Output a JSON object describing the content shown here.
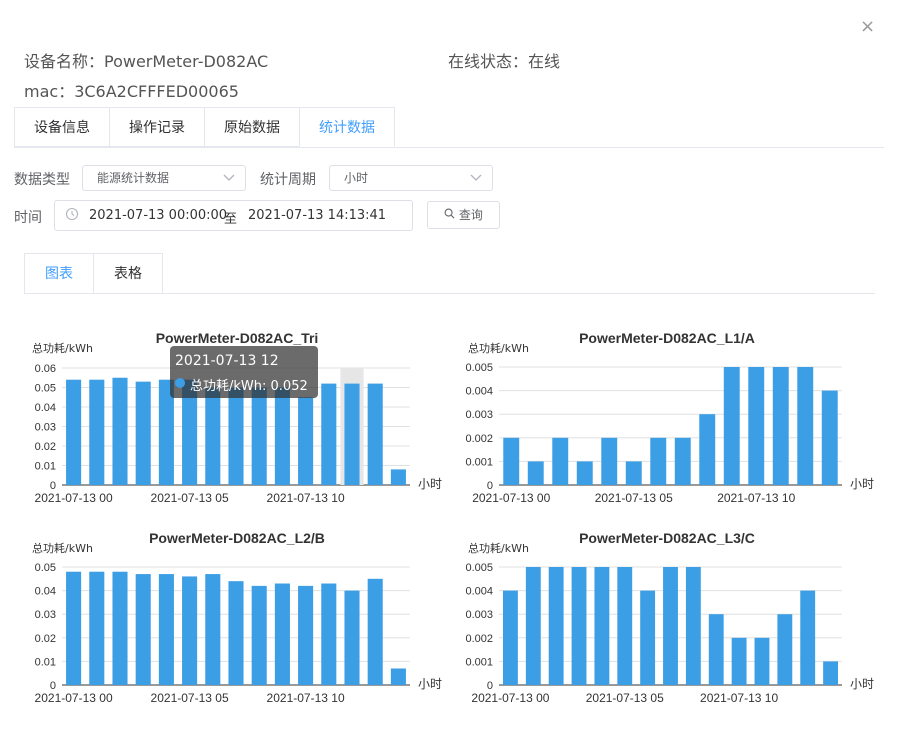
{
  "dialog": {
    "close_glyph": "×",
    "device_name": "设备名称：PowerMeter-D082AC",
    "online_status": "在线状态：在线",
    "mac": "mac：3C6A2CFFFED00065"
  },
  "tabs": [
    "设备信息",
    "操作记录",
    "原始数据",
    "统计数据"
  ],
  "filters": {
    "data_type_label": "数据类型",
    "data_type_value": "能源统计数据",
    "period_label": "统计周期",
    "period_value": "小时",
    "time_label": "时间",
    "start_time": "2021-07-13 00:00:00",
    "range_separator": "至",
    "end_time": "2021-07-13 14:13:41",
    "query_label": "查询",
    "icons": {
      "clock": "clock-icon",
      "search": "search-icon",
      "chevron": "chevron-down-icon"
    }
  },
  "view_tabs": [
    "图表",
    "表格"
  ],
  "tooltip": {
    "title": "2021-07-13 12",
    "value": "总功耗/kWh: 0.052"
  },
  "colors": {
    "bar": "#3c9ee5",
    "accent": "#409eff",
    "highlight": "#e6e6e6"
  },
  "chart_data": [
    {
      "type": "bar",
      "title": "PowerMeter-D082AC_Tri",
      "ylabel": "总功耗/kWh",
      "xlabel": "小时",
      "ylim": [
        0,
        0.06
      ],
      "yticks": [
        "0",
        "0.01",
        "0.02",
        "0.03",
        "0.04",
        "0.05",
        "0.06"
      ],
      "categories": [
        "2021-07-13 00",
        "2021-07-13 01",
        "2021-07-13 02",
        "2021-07-13 03",
        "2021-07-13 04",
        "2021-07-13 05",
        "2021-07-13 06",
        "2021-07-13 07",
        "2021-07-13 08",
        "2021-07-13 09",
        "2021-07-13 10",
        "2021-07-13 11",
        "2021-07-13 12",
        "2021-07-13 13",
        "2021-07-13 14"
      ],
      "xtick_labels": [
        "2021-07-13 00",
        "2021-07-13 05",
        "2021-07-13 10"
      ],
      "values": [
        0.054,
        0.054,
        0.055,
        0.053,
        0.054,
        0.054,
        0.05,
        0.05,
        0.05,
        0.05,
        0.045,
        0.052,
        0.052,
        0.052,
        0.008
      ],
      "highlight_index": 12,
      "grid": true
    },
    {
      "type": "bar",
      "title": "PowerMeter-D082AC_L1/A",
      "ylabel": "总功耗/kWh",
      "xlabel": "小时",
      "ylim": [
        0,
        0.005
      ],
      "yticks": [
        "0",
        "0.001",
        "0.002",
        "0.003",
        "0.004",
        "0.005"
      ],
      "categories": [
        "2021-07-13 00",
        "2021-07-13 01",
        "2021-07-13 02",
        "2021-07-13 03",
        "2021-07-13 04",
        "2021-07-13 05",
        "2021-07-13 06",
        "2021-07-13 07",
        "2021-07-13 08",
        "2021-07-13 09",
        "2021-07-13 10",
        "2021-07-13 11",
        "2021-07-13 12",
        "2021-07-13 13"
      ],
      "xtick_labels": [
        "2021-07-13 00",
        "2021-07-13 05",
        "2021-07-13 10"
      ],
      "values": [
        0.002,
        0.001,
        0.002,
        0.001,
        0.002,
        0.001,
        0.002,
        0.002,
        0.003,
        0.005,
        0.005,
        0.005,
        0.005,
        0.004
      ],
      "grid": true
    },
    {
      "type": "bar",
      "title": "PowerMeter-D082AC_L2/B",
      "ylabel": "总功耗/kWh",
      "xlabel": "小时",
      "ylim": [
        0,
        0.05
      ],
      "yticks": [
        "0",
        "0.01",
        "0.02",
        "0.03",
        "0.04",
        "0.05"
      ],
      "categories": [
        "2021-07-13 00",
        "2021-07-13 01",
        "2021-07-13 02",
        "2021-07-13 03",
        "2021-07-13 04",
        "2021-07-13 05",
        "2021-07-13 06",
        "2021-07-13 07",
        "2021-07-13 08",
        "2021-07-13 09",
        "2021-07-13 10",
        "2021-07-13 11",
        "2021-07-13 12",
        "2021-07-13 13",
        "2021-07-13 14"
      ],
      "xtick_labels": [
        "2021-07-13 00",
        "2021-07-13 05",
        "2021-07-13 10"
      ],
      "values": [
        0.048,
        0.048,
        0.048,
        0.047,
        0.047,
        0.046,
        0.047,
        0.044,
        0.042,
        0.043,
        0.042,
        0.043,
        0.04,
        0.045,
        0.007
      ],
      "grid": true
    },
    {
      "type": "bar",
      "title": "PowerMeter-D082AC_L3/C",
      "ylabel": "总功耗/kWh",
      "xlabel": "小时",
      "ylim": [
        0,
        0.005
      ],
      "yticks": [
        "0",
        "0.001",
        "0.002",
        "0.003",
        "0.004",
        "0.005"
      ],
      "categories": [
        "2021-07-13 00",
        "2021-07-13 01",
        "2021-07-13 02",
        "2021-07-13 03",
        "2021-07-13 04",
        "2021-07-13 05",
        "2021-07-13 06",
        "2021-07-13 07",
        "2021-07-13 08",
        "2021-07-13 09",
        "2021-07-13 10",
        "2021-07-13 11",
        "2021-07-13 12",
        "2021-07-13 13",
        "2021-07-13 14"
      ],
      "xtick_labels": [
        "2021-07-13 00",
        "2021-07-13 05",
        "2021-07-13 10"
      ],
      "values": [
        0.004,
        0.005,
        0.005,
        0.005,
        0.005,
        0.005,
        0.004,
        0.005,
        0.005,
        0.003,
        0.002,
        0.002,
        0.003,
        0.004,
        0.001
      ],
      "grid": true
    }
  ]
}
